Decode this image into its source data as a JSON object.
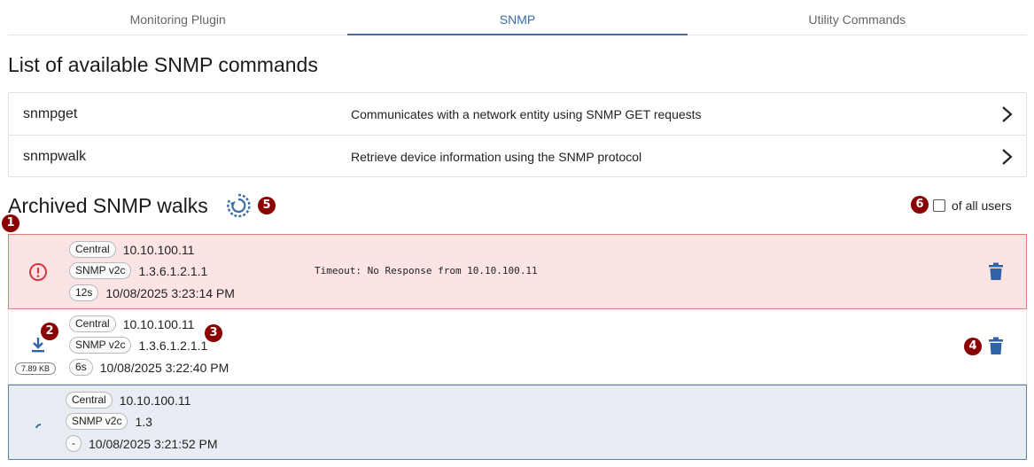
{
  "tabs": [
    {
      "label": "Monitoring Plugin",
      "active": false
    },
    {
      "label": "SNMP",
      "active": true
    },
    {
      "label": "Utility Commands",
      "active": false
    }
  ],
  "commands_title": "List of available SNMP commands",
  "commands": [
    {
      "name": "snmpget",
      "description": "Communicates with a network entity using SNMP GET requests"
    },
    {
      "name": "snmpwalk",
      "description": "Retrieve device information using the SNMP protocol"
    }
  ],
  "archive_title": "Archived SNMP walks",
  "all_users_label": "of all users",
  "markers": [
    "1",
    "2",
    "3",
    "4",
    "5",
    "6"
  ],
  "walks": [
    {
      "state": "error",
      "location": "Central",
      "host": "10.10.100.11",
      "version": "SNMP v2c",
      "oid": "1.3.6.1.2.1.1",
      "duration": "12s",
      "timestamp": "10/08/2025 3:23:14 PM",
      "message": "Timeout: No Response from 10.10.100.11"
    },
    {
      "state": "done",
      "location": "Central",
      "host": "10.10.100.11",
      "version": "SNMP v2c",
      "oid": "1.3.6.1.2.1.1",
      "duration": "6s",
      "timestamp": "10/08/2025 3:22:40 PM",
      "size": "7.89 KB"
    },
    {
      "state": "running",
      "location": "Central",
      "host": "10.10.100.11",
      "version": "SNMP v2c",
      "oid": "1.3",
      "duration": "-",
      "timestamp": "10/08/2025 3:21:52 PM"
    }
  ],
  "colors": {
    "accent": "#3a6ea5",
    "error_bg": "#fde4e4",
    "error_border": "#e07b7b",
    "error_icon": "#d9363e",
    "running_bg": "#e8edf4",
    "marker": "#8b0000",
    "trash": "#2f63a8"
  },
  "icons": {
    "refresh": "refresh-icon",
    "chevron": "chevron-right-icon",
    "error": "alert-circle-icon",
    "delete": "trash-icon",
    "download": "download-icon",
    "spinner": "spinner-icon"
  }
}
